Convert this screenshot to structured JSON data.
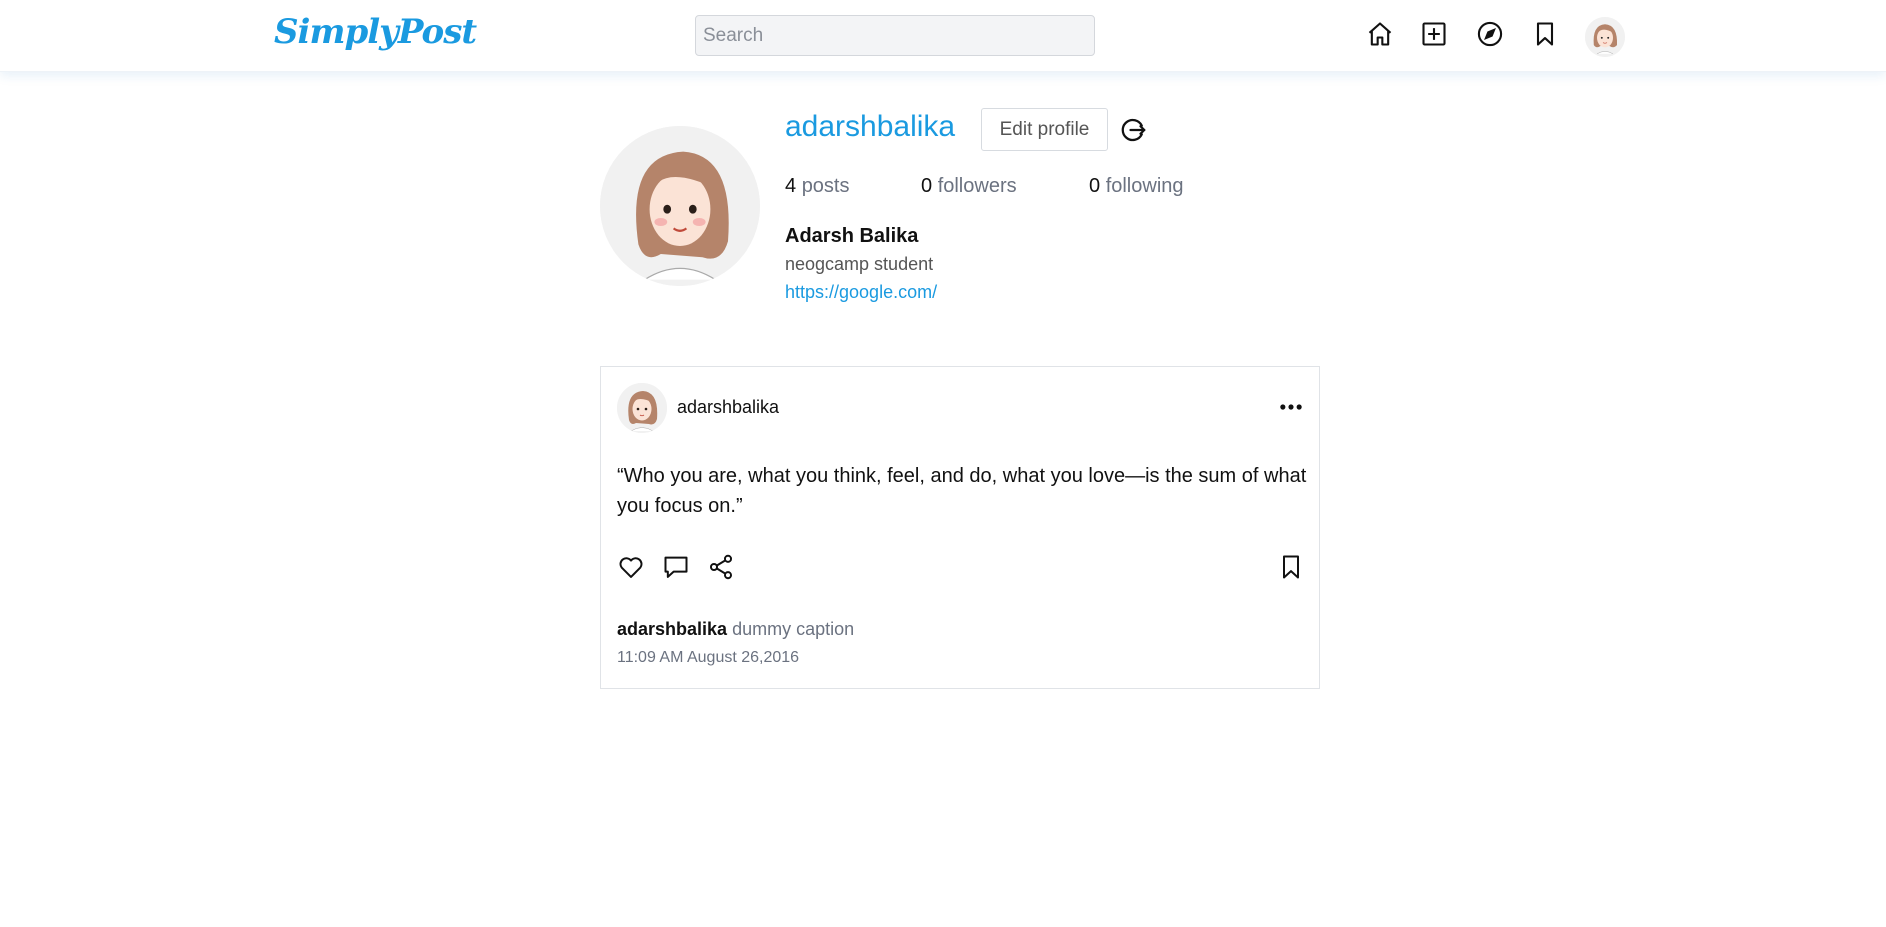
{
  "navbar": {
    "logo_text": "SimplyPost",
    "search_placeholder": "Search",
    "icons": [
      "home-icon",
      "add-post-icon",
      "explore-icon",
      "bookmark-icon",
      "avatar"
    ]
  },
  "profile": {
    "username": "adarshbalika",
    "edit_label": "Edit profile",
    "stats": {
      "posts_count": "4",
      "posts_label": "posts",
      "followers_count": "0",
      "followers_label": "followers",
      "following_count": "0",
      "following_label": "following"
    },
    "full_name": "Adarsh Balika",
    "bio": "neogcamp student",
    "website": "https://google.com/"
  },
  "post": {
    "author": "adarshbalika",
    "content": "“Who you are, what you think, feel, and do, what you love—is the sum of what you focus on.”",
    "caption_user": "adarshbalika",
    "caption_text": "dummy caption",
    "timestamp": "11:09 AM August 26,2016"
  },
  "colors": {
    "accent": "#1a9ae0",
    "muted_text": "#6b7280",
    "border": "#e0e3e7"
  }
}
